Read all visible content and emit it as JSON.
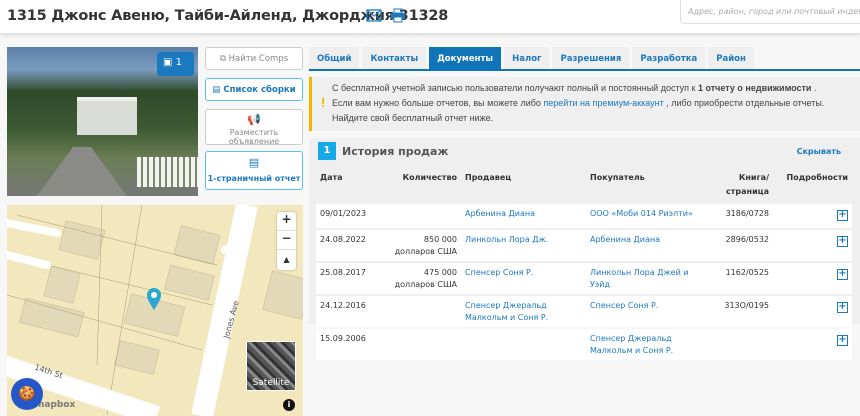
{
  "header": {
    "title": "1315 Джонс Авеню, Тайби-Айленд, Джорджия 31328",
    "search_placeholder": "Адрес, район, город или почтовый индекс"
  },
  "photo": {
    "count": "1"
  },
  "actions": [
    {
      "label": "Найти Comps",
      "icon": "comps-icon"
    },
    {
      "label": "Список сборки",
      "icon": "list-icon"
    },
    {
      "label": "Разместить объявление",
      "icon": "megaphone-icon"
    },
    {
      "label": "1-страничный отчет",
      "icon": "document-icon"
    }
  ],
  "map": {
    "street1": "Jones Ave",
    "street2": "14th St",
    "satellite": "Satellite",
    "attribution": "mapbox",
    "zoom_in": "+",
    "zoom_out": "−"
  },
  "tabs": [
    "Общий",
    "Контакты",
    "Документы",
    "Налог",
    "Разрешения",
    "Разработка",
    "Район"
  ],
  "active_tab": "Документы",
  "notice": {
    "t1": "С бесплатной учетной записью пользователи получают полный и постоянный доступ к ",
    "bold": "1 отчету о недвижимости",
    "t2": " .",
    "t3": "Если вам нужно больше отчетов, вы можете либо ",
    "link": "перейти на премиум-аккаунт",
    "t4": " , либо приобрести отдельные отчеты.",
    "t5": "Найдите свой бесплатный отчет ниже."
  },
  "sales": {
    "number": "1",
    "title": "История продаж",
    "hide": "Скрывать",
    "columns": [
      "Дата",
      "Количество",
      "Продавец",
      "Покупатель",
      "Книга/ страница",
      "Подробности"
    ],
    "rows": [
      {
        "date": "09/01/2023",
        "amount": "",
        "seller": "Арбенина Диана",
        "buyer": "ООО «Моби 014 Риэлти»",
        "book": "3186/0728"
      },
      {
        "date": "24.08.2022",
        "amount": "850 000 долларов США",
        "seller": "Линкольн Лора Дж.",
        "buyer": "Арбенина Диана",
        "book": "2896/0532"
      },
      {
        "date": "25.08.2017",
        "amount": "475 000 долларов США",
        "seller": "Спенсер Соня Р.",
        "buyer": "Линкольн Лора Джей и Уэйд",
        "book": "1162/0525"
      },
      {
        "date": "24.12.2016",
        "amount": "",
        "seller": "Спенсер Джеральд Малкольм и Соня Р.",
        "buyer": "Спенсер Соня Р.",
        "book": "313O/0195"
      },
      {
        "date": "15.09.2006",
        "amount": "",
        "seller": "",
        "buyer": "Спенсер Джеральд Малкольм и Соня Р.",
        "book": ""
      }
    ]
  }
}
